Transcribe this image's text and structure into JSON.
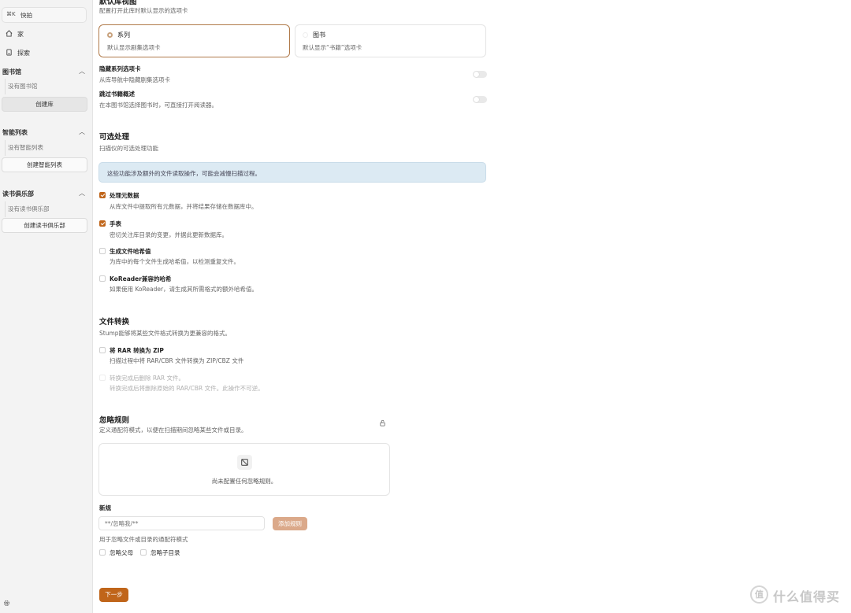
{
  "sidebar": {
    "shortcut": {
      "key": "⌘K",
      "label": "快拍"
    },
    "nav": [
      {
        "label": "家",
        "icon": "home-icon"
      },
      {
        "label": "探索",
        "icon": "book-icon"
      }
    ],
    "library": {
      "title": "图书馆",
      "empty": "没有图书馆",
      "button": "创建库"
    },
    "smart_lists": {
      "title": "智能列表",
      "empty": "没有智能列表",
      "button": "创建智能列表"
    },
    "book_clubs": {
      "title": "读书俱乐部",
      "empty": "没有读书俱乐部",
      "button": "创建读书俱乐部"
    }
  },
  "default_view": {
    "title": "默认库视图",
    "subtitle": "配置打开此库时默认显示的选项卡",
    "options": [
      {
        "title": "系列",
        "desc": "默认显示剧集选项卡",
        "selected": true
      },
      {
        "title": "图书",
        "desc": "默认显示“书籍”选项卡",
        "selected": false
      }
    ]
  },
  "toggles": [
    {
      "title": "隐藏系列选项卡",
      "desc": "从库导航中隐藏剧集选项卡"
    },
    {
      "title": "跳过书籍概述",
      "desc": "在本图书馆选择图书时，可直接打开阅读器。"
    }
  ],
  "optional_processing": {
    "title": "可选处理",
    "subtitle": "扫描仪的可选处理功能",
    "notice": "这些功能涉及额外的文件读取操作，可能会减慢扫描过程。",
    "items": [
      {
        "title": "处理元数据",
        "desc": "从库文件中提取所有元数据，并将结果存储在数据库中。",
        "checked": true
      },
      {
        "title": "手表",
        "desc": "密切关注库目录的变更，并据此更新数据库。",
        "checked": true
      },
      {
        "title": "生成文件哈希值",
        "desc": "为库中的每个文件生成哈希值，以检测重复文件。",
        "checked": false
      },
      {
        "title": "KoReader兼容的哈希",
        "desc": "如果使用 KoReader，请生成其所需格式的额外哈希值。",
        "checked": false
      }
    ]
  },
  "file_conversion": {
    "title": "文件转换",
    "subtitle": "Stump能够将某些文件格式转换为更兼容的格式。",
    "items": [
      {
        "title": "将 RAR 转换为 ZIP",
        "desc": "扫描过程中将 RAR/CBR 文件转换为 ZIP/CBZ 文件"
      },
      {
        "title": "转换完成后删除 RAR 文件。",
        "desc": "转换完成后将删除原始的 RAR/CBR 文件。此操作不可逆。"
      }
    ]
  },
  "ignore_rules": {
    "title": "忽略规则",
    "subtitle": "定义通配符模式，以便在扫描期间忽略某些文件或目录。",
    "empty": "尚未配置任何忽略规则。",
    "new_label": "新规",
    "input_placeholder": "**/忽略我/**",
    "add_button": "添加规则",
    "hint": "用于忽略文件或目录的通配符模式",
    "options": [
      {
        "label": "忽略父母"
      },
      {
        "label": "忽略子目录"
      }
    ]
  },
  "footer": {
    "next_button": "下一步"
  },
  "watermark": {
    "symbol": "值",
    "text": "什么值得买"
  },
  "colors": {
    "accent": "#c0651a",
    "accent_light": "#dba98a",
    "notice_bg": "#dceaf3"
  }
}
